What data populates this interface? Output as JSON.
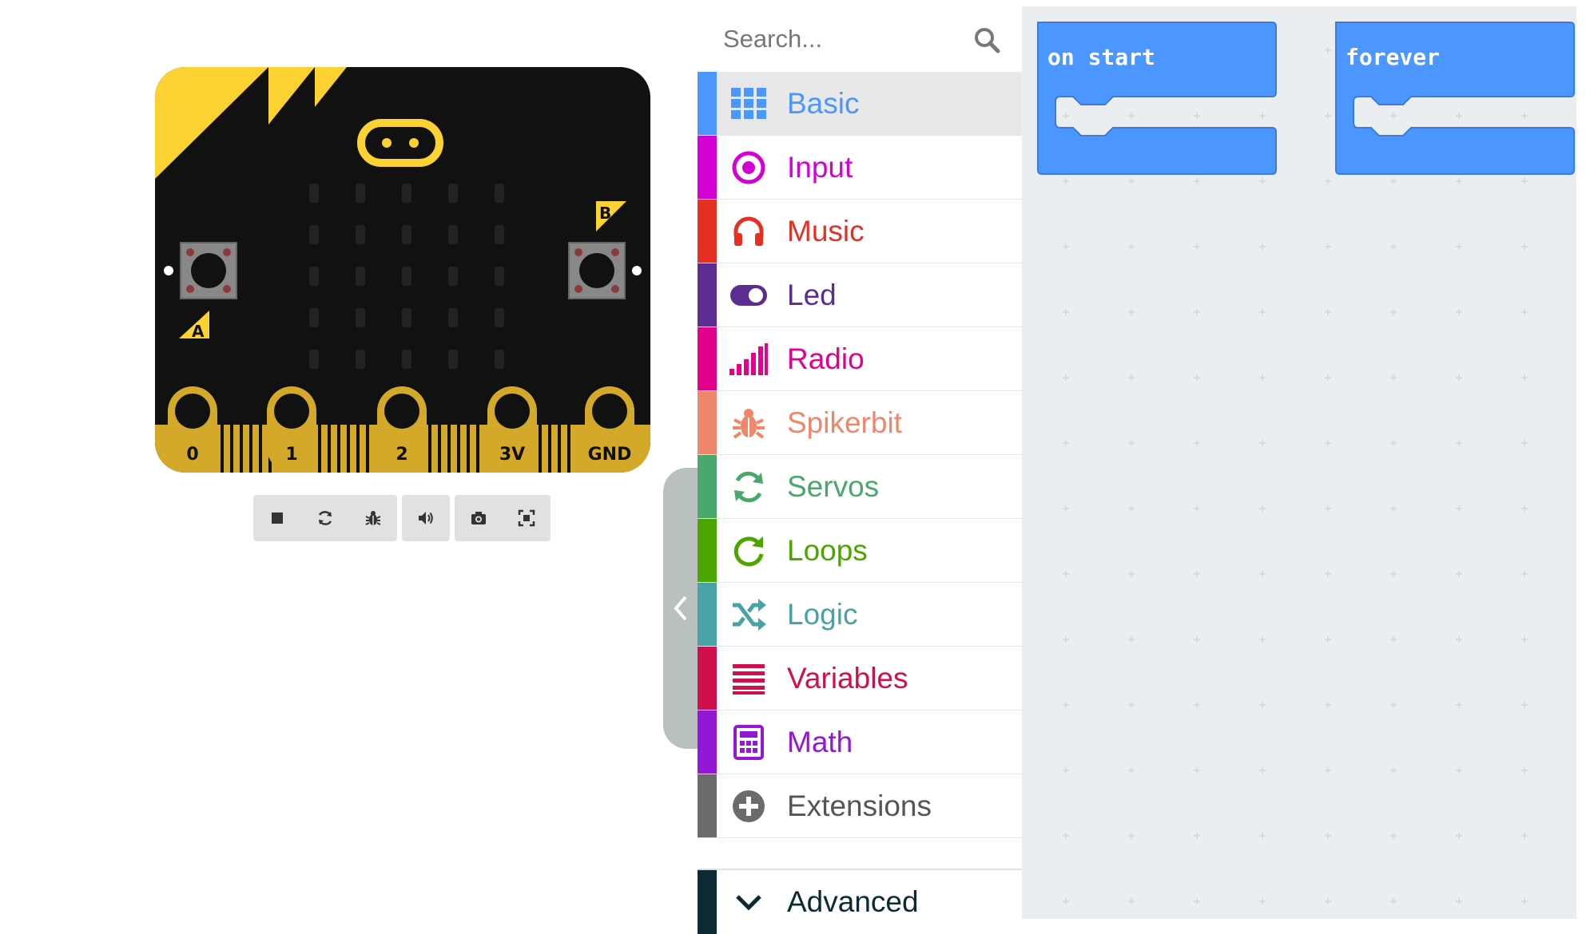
{
  "board": {
    "pins": [
      "0",
      "1",
      "2",
      "3V",
      "GND"
    ],
    "button_a": "A",
    "button_b": "B"
  },
  "sim_toolbar": {
    "buttons": [
      "stop-icon",
      "restart-icon",
      "debug-icon",
      "mute-icon",
      "screenshot-icon",
      "fullscreen-icon"
    ]
  },
  "search": {
    "placeholder": "Search...",
    "value": ""
  },
  "categories": [
    {
      "label": "Basic",
      "color": "#4c97ff",
      "icon": "grid-icon"
    },
    {
      "label": "Input",
      "color": "#d400d4",
      "icon": "target-icon"
    },
    {
      "label": "Music",
      "color": "#e63022",
      "icon": "headphones-icon"
    },
    {
      "label": "Led",
      "color": "#5c2d91",
      "icon": "toggle-icon"
    },
    {
      "label": "Radio",
      "color": "#e3008c",
      "icon": "signal-icon"
    },
    {
      "label": "Spikerbit",
      "color": "#f0866a",
      "icon": "bug-icon"
    },
    {
      "label": "Servos",
      "color": "#4aa86c",
      "icon": "refresh-icon"
    },
    {
      "label": "Loops",
      "color": "#4ca600",
      "icon": "loop-icon"
    },
    {
      "label": "Logic",
      "color": "#47a3a5",
      "icon": "shuffle-icon"
    },
    {
      "label": "Variables",
      "color": "#d0104c",
      "icon": "list-icon"
    },
    {
      "label": "Math",
      "color": "#9317d6",
      "icon": "calculator-icon"
    },
    {
      "label": "Extensions",
      "color": "#6b6b6b",
      "icon": "plus-circle-icon"
    }
  ],
  "advanced": {
    "label": "Advanced",
    "color": "#0b2a33"
  },
  "blocks": {
    "on_start": "on start",
    "forever": "forever",
    "color": "#4c97ff"
  }
}
